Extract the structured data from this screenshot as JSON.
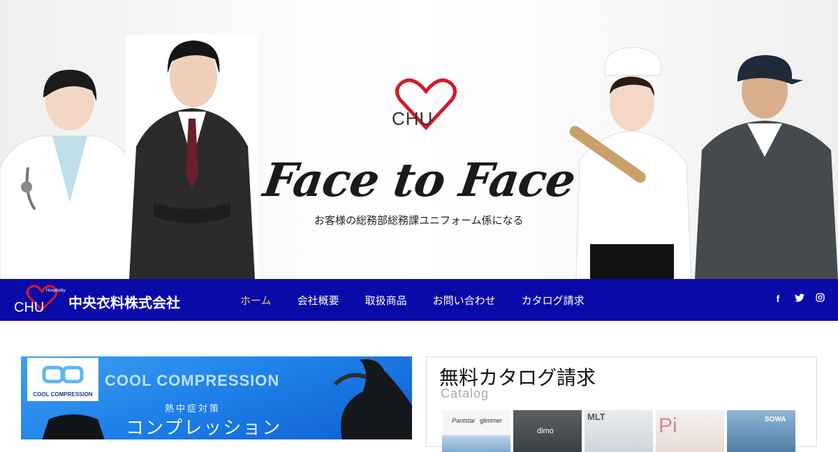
{
  "hero": {
    "logo_text": "CHU",
    "headline": "Face to Face",
    "subline": "お客様の総務部総務課ユニフォーム係になる"
  },
  "nav": {
    "brand_logo_text": "CHU",
    "brand_logo_small": "Hospitality",
    "company_name": "中央衣料株式会社",
    "items": [
      {
        "label": "ホーム",
        "active": true
      },
      {
        "label": "会社概要",
        "active": false
      },
      {
        "label": "取扱商品",
        "active": false
      },
      {
        "label": "お問い合わせ",
        "active": false
      },
      {
        "label": "カタログ請求",
        "active": false
      }
    ],
    "social": [
      {
        "icon": "facebook-icon",
        "glyph": "f"
      },
      {
        "icon": "twitter-icon",
        "glyph": "t"
      },
      {
        "icon": "instagram-icon",
        "glyph": "◎"
      }
    ],
    "colors": {
      "bg": "#0a0aa8",
      "active": "#f5c76a"
    }
  },
  "banner_left": {
    "badge_label": "COOL COMPRESSION",
    "title": "COOL COMPRESSION",
    "heat_label": "熱中症対策",
    "product_label": "コンプレッション"
  },
  "catalog": {
    "title": "無料カタログ請求",
    "subtitle": "Catalog",
    "thumbs": [
      {
        "label1": "Pantstar",
        "label2": "glimmer"
      },
      {
        "label1": "dimo",
        "label2": ""
      },
      {
        "label1": "MLT",
        "label2": ""
      },
      {
        "label1": "Pi",
        "label2": ""
      },
      {
        "label1": "SOWA",
        "label2": ""
      }
    ]
  }
}
